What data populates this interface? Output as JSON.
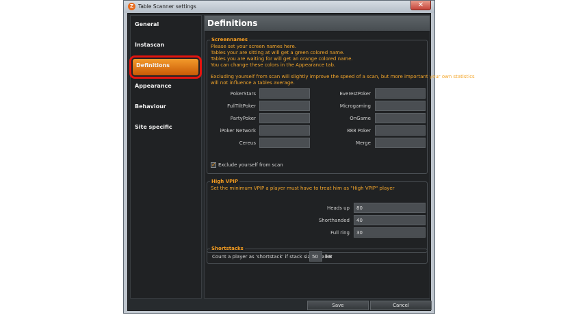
{
  "window": {
    "title": "Table Scanner settings",
    "icon_label": "Z",
    "close_glyph": "✕"
  },
  "sidebar": {
    "items": [
      {
        "label": "General"
      },
      {
        "label": "Instascan"
      },
      {
        "label": "Definitions"
      },
      {
        "label": "Appearance"
      },
      {
        "label": "Behaviour"
      },
      {
        "label": "Site specific"
      }
    ]
  },
  "page": {
    "title": "Definitions"
  },
  "screennames": {
    "legend": "Screennames",
    "lines": [
      "Please set your screen names here.",
      "Tables your are sitting at will get a green colored name.",
      "Tables you are waiting for will get an orange colored name.",
      "You can change these colors in the Appearance tab."
    ],
    "note_1": "Excluding yourself from scan will slightly improve the speed of a scan, but more important your own statistics",
    "note_2": "will not influence a tables average.",
    "left_sites": [
      "PokerStars",
      "FullTiltPoker",
      "PartyPoker",
      "iPoker Network",
      "Cereus"
    ],
    "right_sites": [
      "EverestPoker",
      "Microgaming",
      "OnGame",
      "888 Poker",
      "Merge"
    ],
    "exclude_label": "Exclude yourself from scan",
    "exclude_checked": true
  },
  "high_vpip": {
    "legend": "High VPIP",
    "description": "Set the minimum VPIP a player must have to treat him as \"High VPIP\" player",
    "rows": [
      {
        "label": "Heads up",
        "value": "80"
      },
      {
        "label": "Shorthanded",
        "value": "40"
      },
      {
        "label": "Full ring",
        "value": "30"
      }
    ]
  },
  "shortstacks": {
    "legend": "Shortstacks",
    "label": "Count a player as 'shortstack' if stack size smaller",
    "value": "50",
    "unit": "BB"
  },
  "buttons": {
    "save": "Save",
    "cancel": "Cancel"
  },
  "colors": {
    "accent": "#f49c20",
    "highlight": "#e5140f",
    "background": "#202224"
  }
}
